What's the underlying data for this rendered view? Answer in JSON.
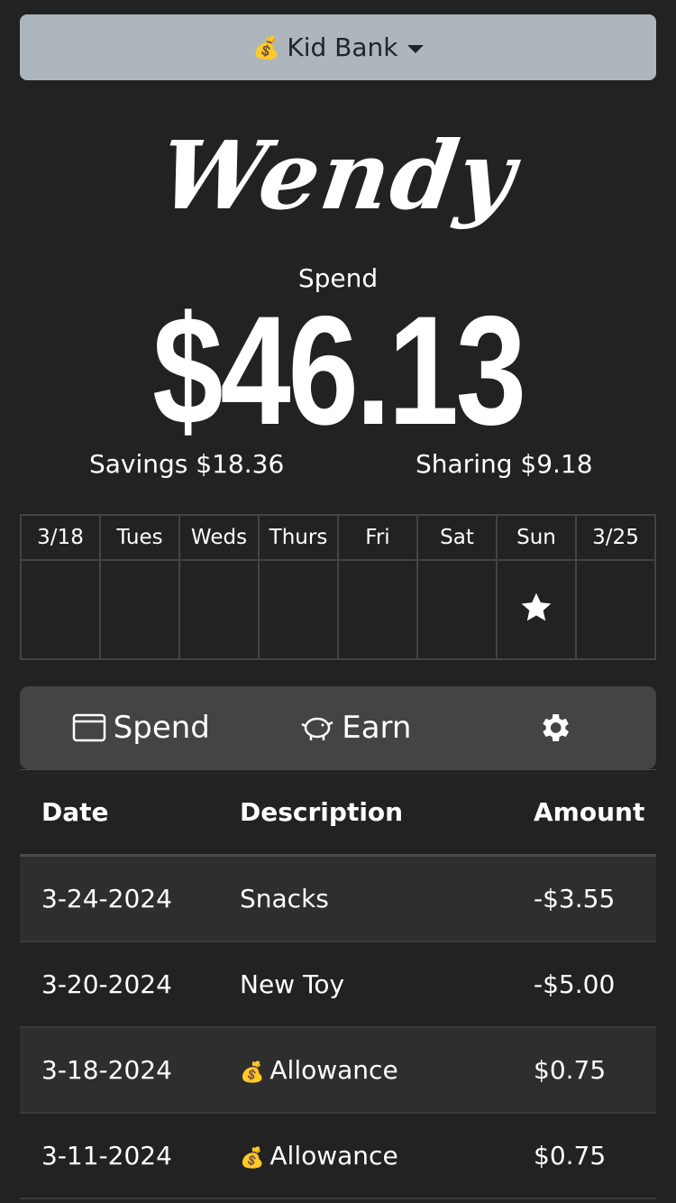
{
  "header": {
    "app_icon": "money-bag-icon",
    "app_name": "Kid Bank"
  },
  "kid": {
    "name": "Wendy"
  },
  "balances": {
    "spend_label": "Spend",
    "spend_value": "$46.13",
    "savings": "Savings $18.36",
    "sharing": "Sharing $9.18"
  },
  "week": {
    "headers": [
      "3/18",
      "Tues",
      "Weds",
      "Thurs",
      "Fri",
      "Sat",
      "Sun",
      "3/25"
    ],
    "star_day": "Sun"
  },
  "tabs": {
    "spend": "Spend",
    "earn": "Earn",
    "settings_icon": "gear-icon"
  },
  "transactions": {
    "headers": {
      "date": "Date",
      "description": "Description",
      "amount": "Amount"
    },
    "rows": [
      {
        "date": "3-24-2024",
        "description": "Snacks",
        "amount": "-$3.55",
        "icon": ""
      },
      {
        "date": "3-20-2024",
        "description": "New Toy",
        "amount": "-$5.00",
        "icon": ""
      },
      {
        "date": "3-18-2024",
        "description": "Allowance",
        "amount": "$0.75",
        "icon": "money-bag-icon"
      },
      {
        "date": "3-11-2024",
        "description": "Allowance",
        "amount": "$0.75",
        "icon": "money-bag-icon"
      }
    ]
  }
}
